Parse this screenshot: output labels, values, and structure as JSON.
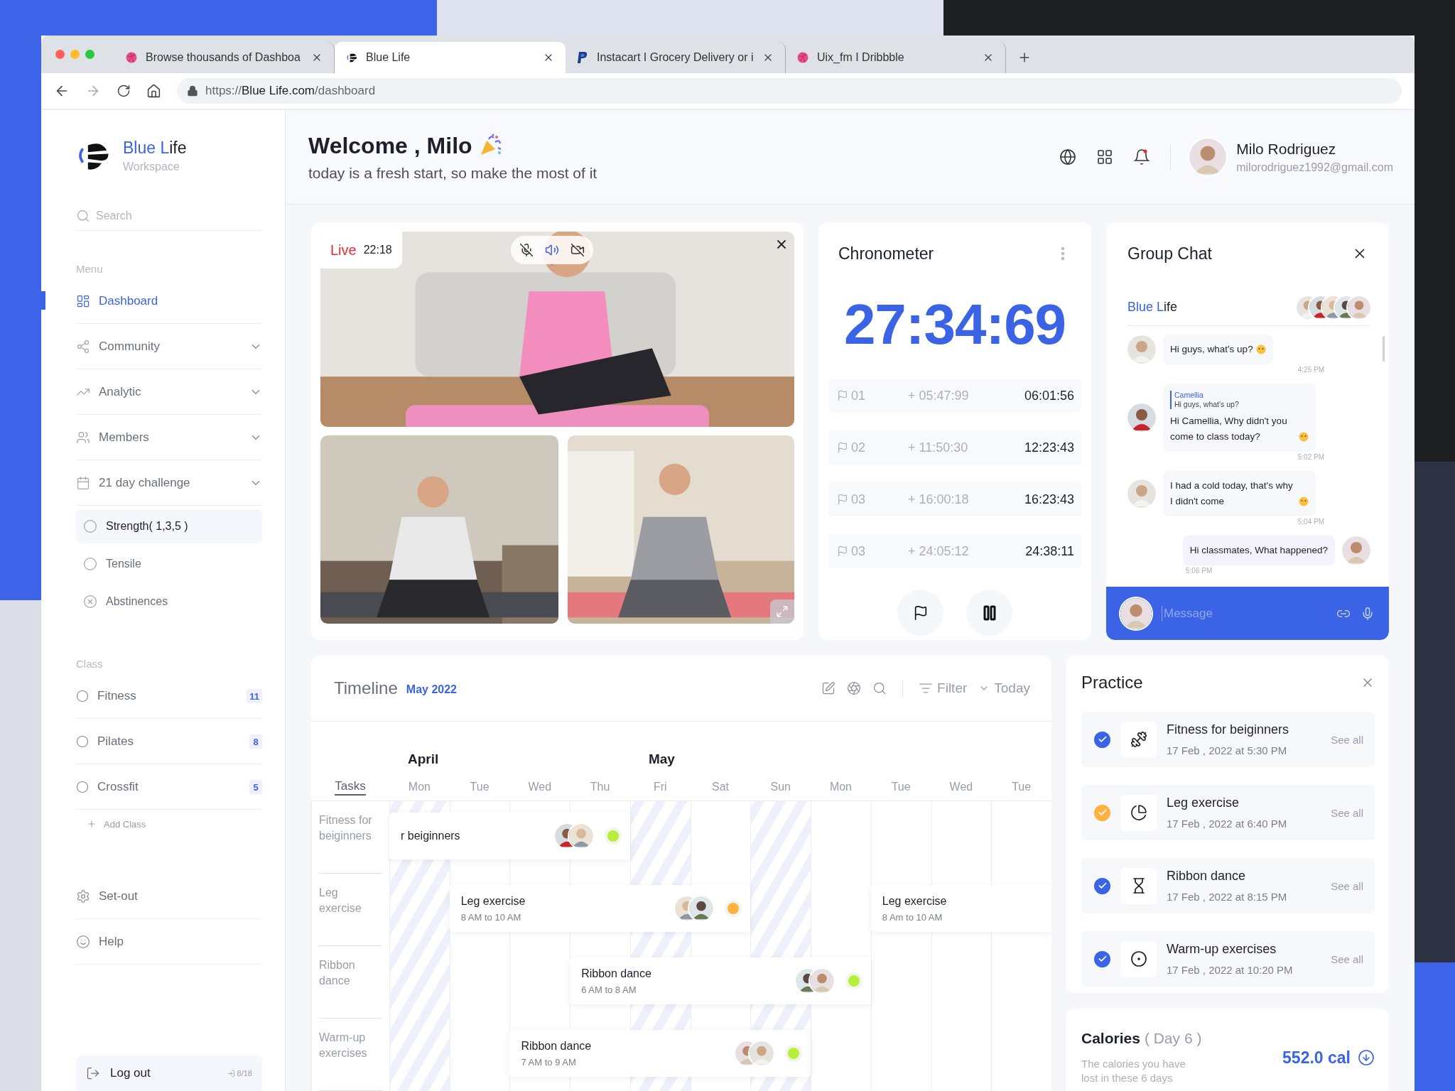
{
  "browser": {
    "tabs": [
      {
        "title": "Browse thousands of Dashboa",
        "selected": false,
        "kind": "ball"
      },
      {
        "title": "Blue Life",
        "selected": true,
        "kind": "logo"
      },
      {
        "title": "Instacart I Grocery Delivery or i",
        "selected": false,
        "kind": "wallet"
      },
      {
        "title": "Uix_fm I Dribbble",
        "selected": false,
        "kind": "ball"
      }
    ],
    "url": "https://**Blue Life.com**/dashboard"
  },
  "sidebar": {
    "brand": {
      "accent": "Blue L",
      "rest": "ife",
      "subtitle": "Workspace"
    },
    "search_placeholder": "Search",
    "menu_heading": "Menu",
    "menu": [
      {
        "label": "Dashboard",
        "selected": true,
        "expandable": false
      },
      {
        "label": "Community",
        "selected": false,
        "expandable": true
      },
      {
        "label": "Analytic",
        "selected": false,
        "expandable": true
      },
      {
        "label": "Members",
        "selected": false,
        "expandable": true
      },
      {
        "label": "21 day challenge",
        "selected": false,
        "expandable": true,
        "children": [
          {
            "label": "Strength( 1,3,5 )",
            "selected": true
          },
          {
            "label": "Tensile",
            "selected": false
          },
          {
            "label": "Abstinences",
            "selected": false
          }
        ]
      }
    ],
    "class_heading": "Class",
    "classes": [
      {
        "label": "Fitness",
        "count": "11"
      },
      {
        "label": "Pilates",
        "count": "8"
      },
      {
        "label": "Crossfit",
        "count": "5"
      }
    ],
    "add_class": "Add Class",
    "footer": [
      {
        "label": "Set-out"
      },
      {
        "label": "Help"
      }
    ],
    "logout": {
      "label": "Log out",
      "count": "8/18"
    }
  },
  "header": {
    "title": "Welcome , Milo",
    "subtitle": "today is a fresh start, so make the most of it",
    "user": {
      "name": "Milo Rodriguez",
      "email": "milorodriguez1992@gmail.com"
    }
  },
  "live": {
    "label": "Live",
    "time": "22:18"
  },
  "chronometer": {
    "title": "Chronometer",
    "time": "27:34:69",
    "laps": [
      {
        "number": "01",
        "split": "+ 05:47:99",
        "total": "06:01:56"
      },
      {
        "number": "02",
        "split": "+ 11:50:30",
        "total": "12:23:43"
      },
      {
        "number": "03",
        "split": "+ 16:00:18",
        "total": "16:23:43"
      },
      {
        "number": "03",
        "split": "+ 24:05:12",
        "total": "24:38:11"
      }
    ]
  },
  "chat": {
    "title": "Group Chat",
    "group": {
      "accent": "Blue L",
      "rest": "ife"
    },
    "messages": [
      {
        "kind": "in",
        "text": "Hi guys, what's up?",
        "emoji": true,
        "time": "4:25 PM"
      },
      {
        "kind": "in",
        "reply": {
          "name": "Camellia",
          "text": "Hi guys, what's up?"
        },
        "text": "Hi Camellia, Why didn't you come to class today?",
        "emoji": true,
        "time": "5:02 PM"
      },
      {
        "kind": "in",
        "text": "I had a cold today, that's why I didn't come",
        "emoji": true,
        "time": "5:04 PM"
      },
      {
        "kind": "out",
        "text": "Hi classmates, What happened?",
        "emoji": false,
        "time": "5:06 PM"
      }
    ],
    "placeholder": "Message"
  },
  "timeline": {
    "title": "Timeline",
    "period": "May 2022",
    "filter": "Filter",
    "today": "Today",
    "tasks_label": "Tasks",
    "days": [
      {
        "label": "Mon",
        "month": "April",
        "striped": true
      },
      {
        "label": "Tue",
        "striped": false
      },
      {
        "label": "Wed",
        "striped": false
      },
      {
        "label": "Thu",
        "striped": false
      },
      {
        "label": "Fri",
        "month": "May",
        "striped": true
      },
      {
        "label": "Sat",
        "striped": false
      },
      {
        "label": "Sun",
        "striped": true
      },
      {
        "label": "Mon",
        "striped": false
      },
      {
        "label": "Tue",
        "striped": false
      },
      {
        "label": "Wed",
        "striped": false
      },
      {
        "label": "Tue",
        "striped": false
      }
    ],
    "rows": [
      {
        "label": "Fitness for beiginners",
        "cells": [
          {
            "kind": "event",
            "title": "r beiginners",
            "color": "#b8ef3a"
          },
          {
            "kind": "continue"
          },
          {
            "kind": "continue"
          },
          {
            "kind": "continue"
          },
          {
            "kind": "empty"
          },
          {
            "kind": "empty"
          },
          {
            "kind": "empty"
          },
          {
            "kind": "empty"
          },
          {
            "kind": "empty"
          },
          {
            "kind": "empty"
          },
          {
            "kind": "empty"
          }
        ]
      },
      {
        "label": "Leg exercise",
        "cells": [
          {
            "kind": "empty"
          },
          {
            "kind": "event",
            "title": "Leg exercise",
            "time": "8 AM to 10 AM",
            "color": "#ffb23e"
          },
          {
            "kind": "continue"
          },
          {
            "kind": "continue"
          },
          {
            "kind": "continue"
          },
          {
            "kind": "continue"
          },
          {
            "kind": "empty"
          },
          {
            "kind": "empty"
          },
          {
            "kind": "plain_event",
            "title": "Leg exercise",
            "time": "8 Am to 10 AM"
          },
          {
            "kind": "continue"
          },
          {
            "kind": "continue"
          }
        ]
      },
      {
        "label": "Ribbon dance",
        "cells": [
          {
            "kind": "empty"
          },
          {
            "kind": "empty"
          },
          {
            "kind": "empty"
          },
          {
            "kind": "event",
            "title": "Ribbon dance",
            "time": "6 AM to 8 AM",
            "color": "#b8ef3a"
          },
          {
            "kind": "continue"
          },
          {
            "kind": "continue"
          },
          {
            "kind": "continue"
          },
          {
            "kind": "continue"
          },
          {
            "kind": "empty"
          },
          {
            "kind": "empty"
          },
          {
            "kind": "empty"
          }
        ]
      },
      {
        "label": "Warm-up exercises",
        "cells": [
          {
            "kind": "empty"
          },
          {
            "kind": "empty"
          },
          {
            "kind": "event",
            "title": "Ribbon dance",
            "time": "7 AM to 9 AM",
            "color": "#b8ef3a"
          },
          {
            "kind": "continue"
          },
          {
            "kind": "continue"
          },
          {
            "kind": "continue"
          },
          {
            "kind": "continue"
          },
          {
            "kind": "empty"
          },
          {
            "kind": "empty"
          },
          {
            "kind": "empty"
          },
          {
            "kind": "empty"
          }
        ]
      }
    ]
  },
  "practice": {
    "title": "Practice",
    "items": [
      {
        "title": "Fitness for beiginners",
        "date": "17 Feb , 2022 at 5:30 PM",
        "action": "See all",
        "color": "#3a63e6"
      },
      {
        "title": "Leg exercise",
        "date": "17 Feb , 2022 at 6:40 PM",
        "action": "See all",
        "color": "#ffb23e"
      },
      {
        "title": "Ribbon dance",
        "date": "17 Feb , 2022 at 8:15 PM",
        "action": "See all",
        "color": "#3a63e6"
      },
      {
        "title": "Warm-up exercises",
        "date": "17 Feb , 2022 at 10:20 PM",
        "action": "See all",
        "color": "#3a63e6"
      }
    ]
  },
  "calories": {
    "title": "Calories",
    "day": "( Day 6 )",
    "description": "The calories you have lost in these 6 days",
    "value": "552.0 cal"
  }
}
